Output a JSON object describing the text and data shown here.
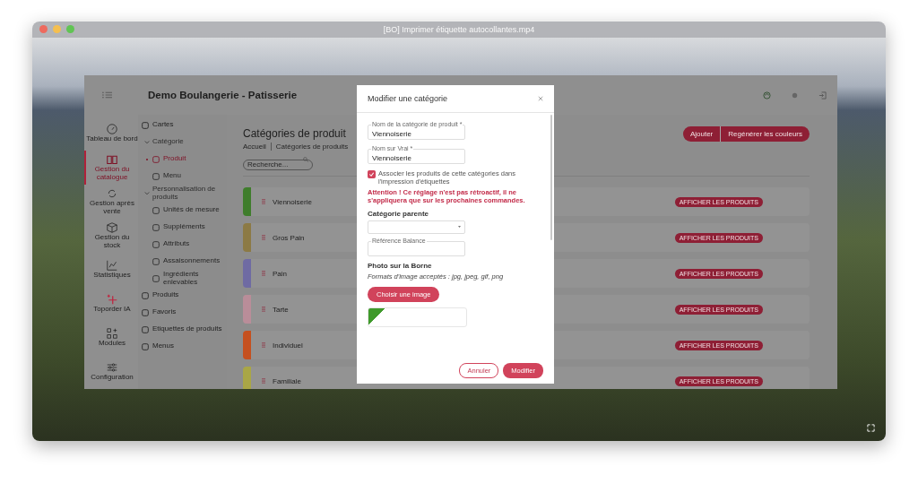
{
  "player": {
    "title": "[BO] Imprimer étiquette autocollantes.mp4"
  },
  "app": {
    "title": "Demo Boulangerie - Patisserie"
  },
  "main_nav": [
    {
      "label": "Tableau de bord",
      "selected": false
    },
    {
      "label": "Gestion du catalogue",
      "selected": true
    },
    {
      "label": "Gestion après vente",
      "selected": false
    },
    {
      "label": "Gestion du stock",
      "selected": false
    },
    {
      "label": "Statistiques",
      "selected": false
    },
    {
      "label": "Toporder IA",
      "selected": false
    },
    {
      "label": "Modules",
      "selected": false
    },
    {
      "label": "Configuration",
      "selected": false
    }
  ],
  "sub_nav": [
    {
      "label": "Cartes",
      "selected": false
    },
    {
      "label": "Catégorie",
      "expanded": true,
      "children": [
        {
          "label": "Produit",
          "selected": true
        },
        {
          "label": "Menu",
          "selected": false
        }
      ]
    },
    {
      "label": "Personnalisation de produits",
      "expanded": true,
      "children": [
        {
          "label": "Unités de mesure",
          "selected": false
        },
        {
          "label": "Suppléments",
          "selected": false
        },
        {
          "label": "Attributs",
          "selected": false
        },
        {
          "label": "Assaisonnements",
          "selected": false
        },
        {
          "label": "Ingrédients enlevables",
          "selected": false
        }
      ]
    },
    {
      "label": "Produits",
      "selected": false
    },
    {
      "label": "Favoris",
      "selected": false
    },
    {
      "label": "Etiquettes de produits",
      "selected": false
    },
    {
      "label": "Menus",
      "selected": false
    }
  ],
  "page": {
    "title": "Catégories de produit",
    "breadcrumb": [
      "Accueil",
      "Catégories de produits"
    ],
    "search": {
      "placeholder": "Recherche..."
    },
    "actions": [
      "Ajouter",
      "Regénérer les couleurs"
    ]
  },
  "categories": [
    {
      "name": "Viennoiserie",
      "color": "#3f7d2c",
      "action": "AFFICHER LES PRODUITS"
    },
    {
      "name": "Gros Pain",
      "color": "#8c7a45",
      "action": "AFFICHER LES PRODUITS"
    },
    {
      "name": "Pain",
      "color": "#6f6ba3",
      "action": "AFFICHER LES PRODUITS"
    },
    {
      "name": "Tarte",
      "color": "#b98d99",
      "action": "AFFICHER LES PRODUITS"
    },
    {
      "name": "Individuel",
      "color": "#c5501f",
      "action": "AFFICHER LES PRODUITS"
    },
    {
      "name": "Familiale",
      "color": "#a9a646",
      "action": "AFFICHER LES PRODUITS"
    }
  ],
  "modal": {
    "title": "Modifier une catégorie",
    "fields": [
      {
        "label": "Nom de la catégorie de produit *",
        "value": "Viennoiserie"
      },
      {
        "label": "Nom sur Vrai *",
        "value": "Viennoiserie"
      }
    ],
    "checkbox": {
      "label": "Associer les produits de cette catégories dans l'impression d'étiquettes",
      "checked": true
    },
    "warning": "Attention ! Ce réglage n'est pas rétroactif, il ne s'appliquera que sur les prochaines commandes.",
    "parent_heading": "Catégorie parente",
    "reference_field": {
      "label": "Référence Balance"
    },
    "photo_heading": "Photo sur la Borne",
    "formats": "Formats d'image acceptés : jpg, jpeg, gif, png",
    "choose_button": "Choisir une image",
    "buttons": [
      "Annuler",
      "Modifier"
    ]
  }
}
